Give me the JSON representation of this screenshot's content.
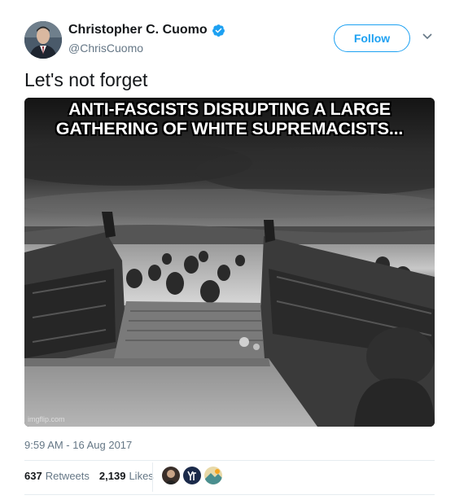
{
  "author": {
    "display_name": "Christopher C. Cuomo",
    "handle": "@ChrisCuomo",
    "verified": true
  },
  "follow_label": "Follow",
  "tweet_text": "Let's not forget",
  "media": {
    "caption": "ANTI-FASCISTS DISRUPTING A LARGE GATHERING OF WHITE SUPREMACISTS...",
    "watermark": "imgflip.com"
  },
  "timestamp": "9:59 AM - 16 Aug 2017",
  "stats": {
    "retweets_count": "637",
    "retweets_label": "Retweets",
    "likes_count": "2,139",
    "likes_label": "Likes"
  },
  "colors": {
    "accent": "#1da1f2",
    "secondary_text": "#657786",
    "divider": "#e6ecf0"
  },
  "icons": [
    "verified-badge-icon",
    "chevron-down-icon"
  ]
}
